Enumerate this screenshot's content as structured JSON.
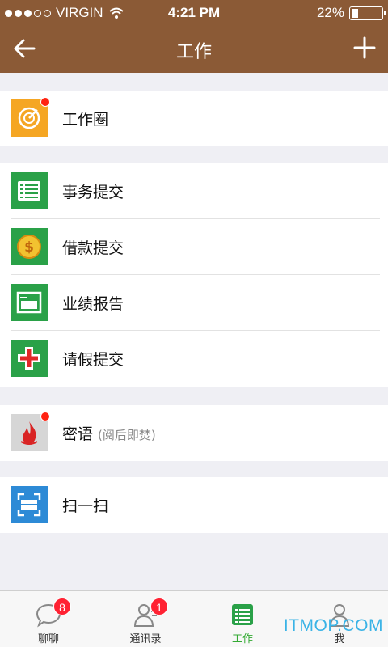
{
  "status": {
    "carrier": "VIRGIN",
    "time": "4:21 PM",
    "battery": "22%",
    "battery_level": 0.22
  },
  "nav": {
    "title": "工作",
    "back_icon": "arrow-left-icon",
    "add_icon": "plus-icon"
  },
  "groups": {
    "circle": {
      "label": "工作圈",
      "icon": "work-circle-icon",
      "color": "#f5a623",
      "has_dot": true
    },
    "tasks": [
      {
        "label": "事务提交",
        "icon": "list-icon",
        "color": "#2aa148"
      },
      {
        "label": "借款提交",
        "icon": "coin-icon",
        "color": "#2aa148"
      },
      {
        "label": "业绩报告",
        "icon": "report-icon",
        "color": "#2aa148"
      },
      {
        "label": "请假提交",
        "icon": "cross-icon",
        "color": "#2aa148"
      }
    ],
    "secret": {
      "label": "密语",
      "sub": "(阅后即焚)",
      "icon": "flame-icon",
      "color": "#d6d6d6",
      "has_dot": true
    },
    "scan": {
      "label": "扫一扫",
      "icon": "scan-icon",
      "color": "#2d8ad6"
    }
  },
  "tabs": [
    {
      "label": "聊聊",
      "icon": "chat-bubble-icon",
      "badge": "8"
    },
    {
      "label": "通讯录",
      "icon": "contacts-icon",
      "badge": "1"
    },
    {
      "label": "工作",
      "icon": "work-icon",
      "active": true
    },
    {
      "label": "我",
      "icon": "person-icon"
    }
  ],
  "watermark": "ITMOP.COM"
}
